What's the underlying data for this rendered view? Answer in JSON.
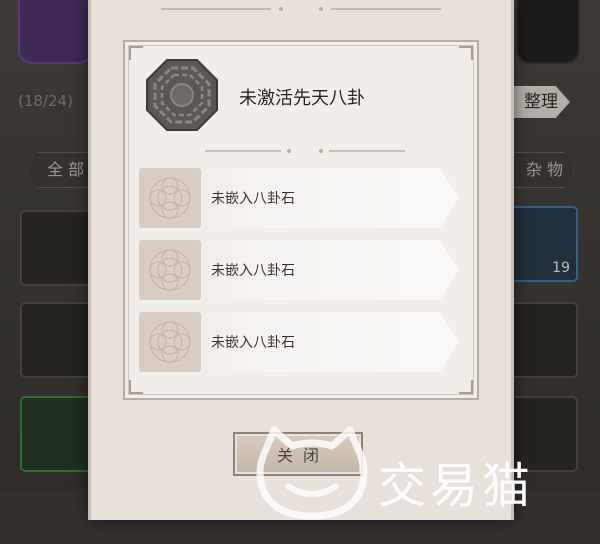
{
  "background": {
    "bag_count": "(18/24)",
    "sort_button": "一键整理",
    "sort_visible": "整理",
    "tab_all": "全部",
    "tab_all_visible": "全 部",
    "tab_misc": "杂物",
    "tab_misc_visible": "杂 物",
    "item_count": "19"
  },
  "dialog": {
    "title": "未激活先天八卦",
    "icon": "bagua-icon",
    "slots": [
      {
        "label": "未嵌入八卦石",
        "icon": "empty-socket-icon"
      },
      {
        "label": "未嵌入八卦石",
        "icon": "empty-socket-icon"
      },
      {
        "label": "未嵌入八卦石",
        "icon": "empty-socket-icon"
      }
    ],
    "close_label": "关闭"
  },
  "watermark": {
    "text": "交易猫",
    "icon": "cat-logo-icon"
  },
  "colors": {
    "panel": "#f1ede8",
    "dialog": "#e8e1da",
    "accent": "#a89c8f"
  }
}
